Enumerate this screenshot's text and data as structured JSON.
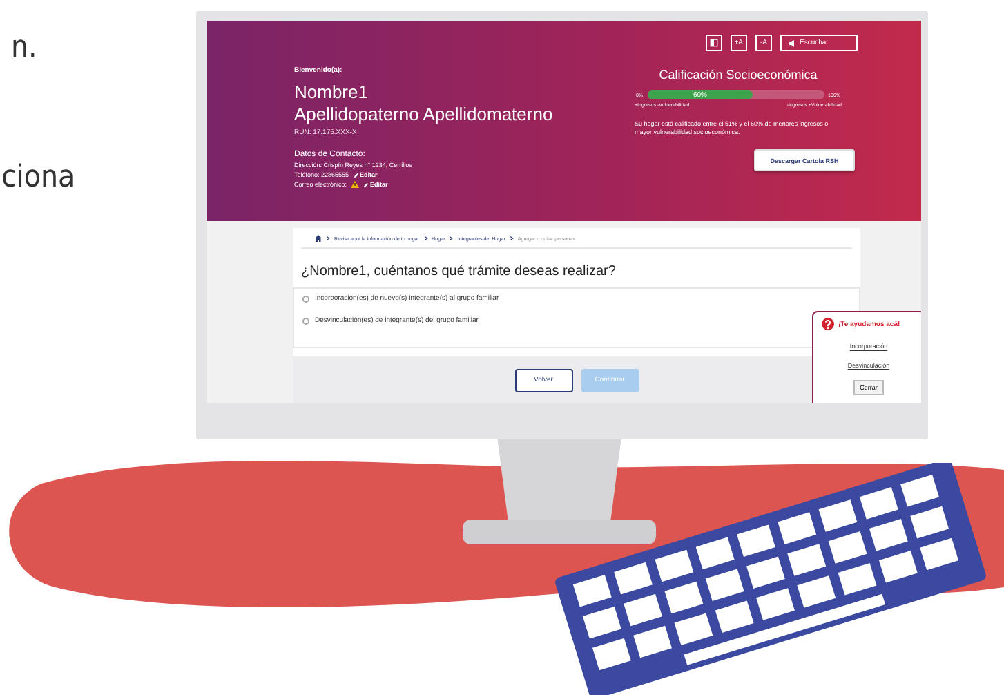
{
  "side_text": [
    "n.",
    "ciona"
  ],
  "header": {
    "tools": [
      {
        "kind": "contrast"
      },
      {
        "kind": "text",
        "label": "+A"
      },
      {
        "kind": "text",
        "label": "-A"
      },
      {
        "kind": "listen",
        "label": "Escuchar"
      }
    ],
    "welcome": "Bienvenido(a):",
    "first_name": "Nombre1",
    "last_names": "Apellidopaterno Apellidomaterno",
    "run": "RUN: 17.175.XXX-X",
    "contact_title": "Datos de Contacto:",
    "contact": [
      {
        "label": "Dirección: Crispín Reyes n° 1234, Cerrillos",
        "warning": false
      },
      {
        "label": "Teléfono: 22865555",
        "warning": false,
        "edit": "Editar"
      },
      {
        "label": "Correo electrónico:",
        "warning": true,
        "edit": "Editar"
      }
    ],
    "score": {
      "title": "Calificación Socioeconómica",
      "min": "0%",
      "max": "100%",
      "value_label": "60%",
      "level": 0.6,
      "left_caption": "+Ingresos -Vulnerabilidad",
      "right_caption": "-Ingresos +Vulnerabilidad",
      "text": "Su hogar está calificado entre el 51% y el 60% de menores ingresos o mayor vulnerabilidad socioeconómica.",
      "button": "Descargar Cartola RSH"
    }
  },
  "breadcrumb": [
    {
      "label": "Revisa aquí la información de tu hogar",
      "current": false
    },
    {
      "label": "Hogar",
      "current": false
    },
    {
      "label": "Integrantes del Hogar",
      "current": false
    },
    {
      "label": "Agregar o quitar personas",
      "current": true
    }
  ],
  "question": "¿Nombre1, cuéntanos qué trámite deseas realizar?",
  "options": [
    {
      "label": "Incorporacion(es) de nuevo(s) integrante(s) al grupo familiar",
      "selected": false
    },
    {
      "label": "Desvinculación(es) de integrante(s) del grupo familiar",
      "selected": false
    }
  ],
  "buttons": [
    {
      "label": "Volver",
      "disabled": false
    },
    {
      "label": "Continuar",
      "disabled": true
    }
  ],
  "help": {
    "title": "¡Te ayudamos acá!",
    "links": [
      "Incorporación",
      "Desvinculación"
    ],
    "close": "Cerrar"
  }
}
